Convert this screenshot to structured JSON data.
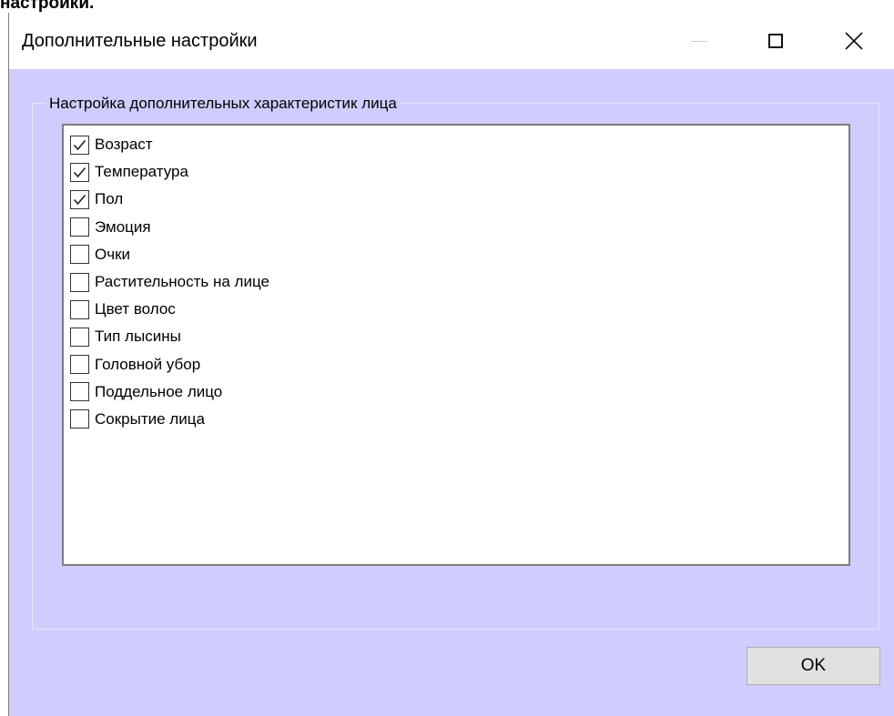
{
  "page": {
    "caption": "настройки."
  },
  "window": {
    "title": "Дополнительные настройки",
    "controls": {
      "minimize": "minimize-icon",
      "maximize": "maximize-icon",
      "close": "close-icon"
    }
  },
  "group": {
    "legend": "Настройка дополнительных характеристик лица",
    "items": [
      {
        "label": "Возраст",
        "checked": true
      },
      {
        "label": "Температура",
        "checked": true
      },
      {
        "label": "Пол",
        "checked": true
      },
      {
        "label": "Эмоция",
        "checked": false
      },
      {
        "label": "Очки",
        "checked": false
      },
      {
        "label": "Растительность на лице",
        "checked": false
      },
      {
        "label": "Цвет волос",
        "checked": false
      },
      {
        "label": "Тип лысины",
        "checked": false
      },
      {
        "label": "Головной убор",
        "checked": false
      },
      {
        "label": "Поддельное лицо",
        "checked": false
      },
      {
        "label": "Сокрытие лица",
        "checked": false
      }
    ]
  },
  "buttons": {
    "ok": "OK"
  },
  "colors": {
    "dialog_background": "#cfcdfe",
    "titlebar_background": "#ffffff",
    "button_background": "#e1e1e1"
  }
}
